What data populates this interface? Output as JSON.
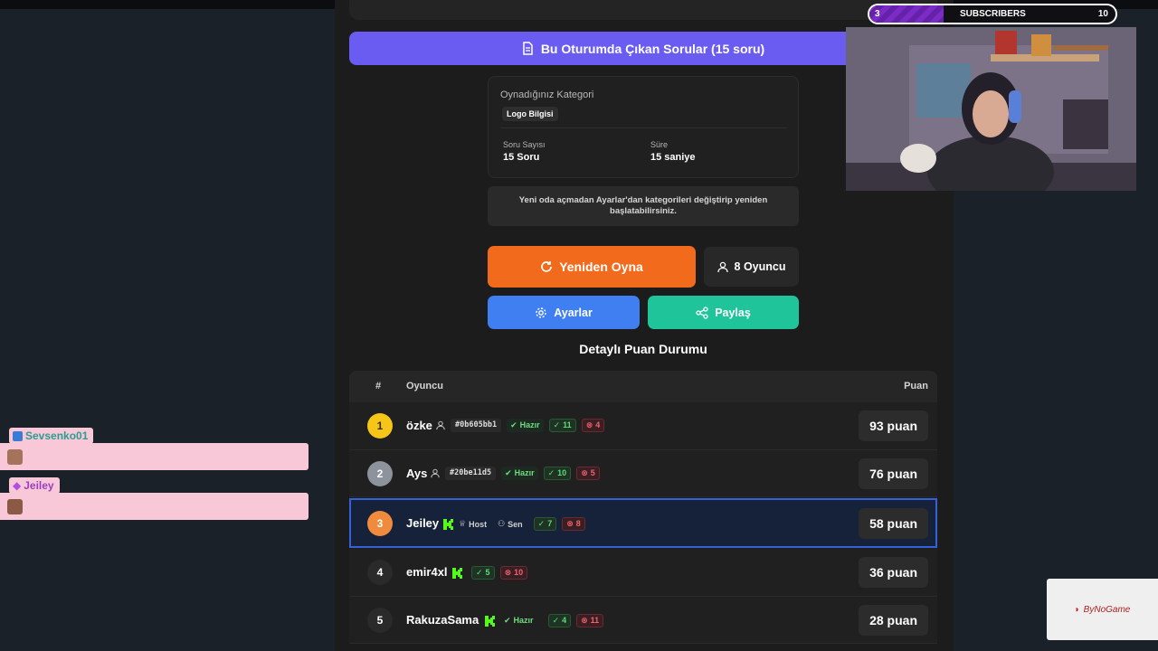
{
  "overlay": {
    "subscribers": {
      "label": "SUBSCRIBERS",
      "current": "3",
      "goal": "10",
      "progress": 0.3
    },
    "chat": [
      {
        "user": "Sevsenko01",
        "color": "#6ef0a8"
      },
      {
        "user": "Jeiley",
        "color": "#e6a3ff"
      }
    ],
    "logo_text": "ByNoGame"
  },
  "game": {
    "questions_button": "Bu Oturumda Çıkan Sorular (15 soru)",
    "category": {
      "heading": "Oynadığınız Kategori",
      "name": "Logo Bilgisi",
      "count_label": "Soru Sayısı",
      "count_value": "15 Soru",
      "time_label": "Süre",
      "time_value": "15 saniye"
    },
    "notice": "Yeni oda açmadan Ayarlar'dan kategorileri değiştirip yeniden başlatabilirsiniz.",
    "buttons": {
      "replay": "Yeniden Oyna",
      "players": "8 Oyuncu",
      "settings": "Ayarlar",
      "share": "Paylaş"
    },
    "score_title": "Detaylı Puan Durumu",
    "table": {
      "col_rank": "#",
      "col_player": "Oyuncu",
      "col_score": "Puan",
      "rows": [
        {
          "rank": "1",
          "name": "özke",
          "tag": "#0b605bb1",
          "status": "Hazır",
          "correct": "11",
          "wrong": "4",
          "score": "93 puan"
        },
        {
          "rank": "2",
          "name": "Ays",
          "tag": "#20be11d5",
          "status": "Hazır",
          "correct": "10",
          "wrong": "5",
          "score": "76 puan"
        },
        {
          "rank": "3",
          "name": "Jeiley",
          "host": "Host",
          "you": "Sen",
          "correct": "7",
          "wrong": "8",
          "score": "58 puan"
        },
        {
          "rank": "4",
          "name": "emir4xl",
          "correct": "5",
          "wrong": "10",
          "score": "36 puan"
        },
        {
          "rank": "5",
          "name": "RakuzaSama",
          "status": "Hazır",
          "correct": "4",
          "wrong": "11",
          "score": "28 puan"
        }
      ]
    }
  },
  "colors": {
    "accent": "#6a5cf0",
    "orange": "#f26b1d",
    "blue": "#3f7ff2",
    "teal": "#1fc49a",
    "gold": "#f5c518",
    "silver": "#8c939c",
    "bronze": "#f08a3c",
    "kick": "#53fc18"
  }
}
